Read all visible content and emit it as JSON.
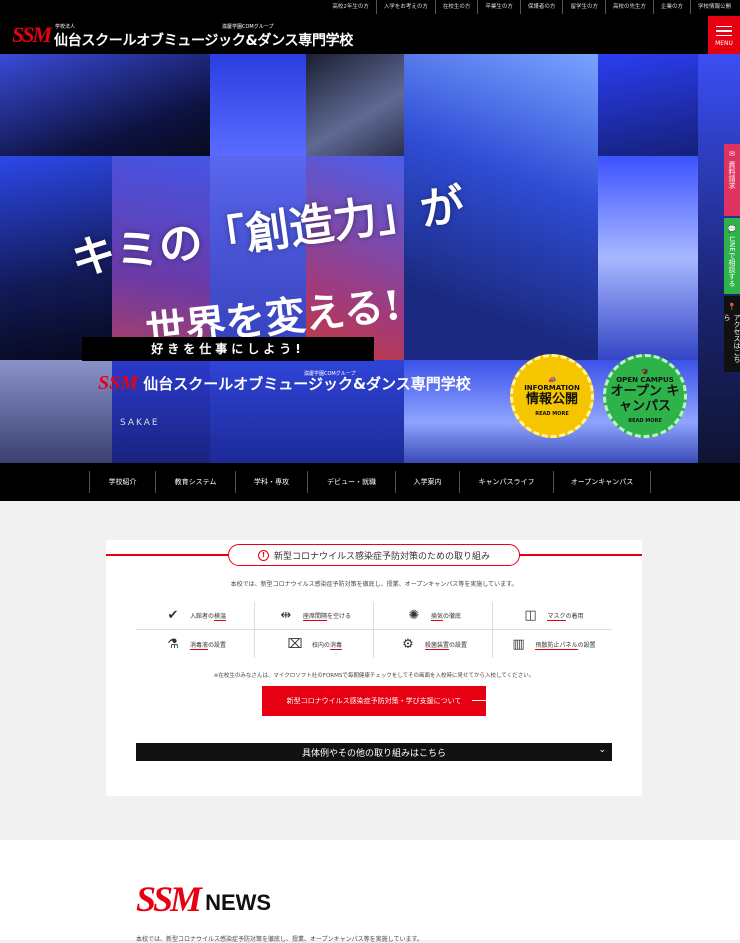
{
  "topbar": {
    "links": [
      "高校2年生の方",
      "入学をお考えの方",
      "在校生の方",
      "卒業生の方",
      "保護者の方",
      "留学生の方",
      "高校の先生方",
      "企業の方",
      "学校情報公開"
    ]
  },
  "header": {
    "logo_mark": "SSM",
    "corp_label": "学校法人",
    "group_label": "滋慶学園COMグループ",
    "school_name": "仙台スクールオブミュージック&ダンス専門学校",
    "menu_label": "MENU"
  },
  "hero": {
    "copy_line1": "キミの「創造力」が",
    "copy_line2": "世界を変える!",
    "tagline": "好きを仕事にしよう!",
    "logo_mark": "SSM",
    "logo_name": "仙台スクールオブミュージック&ダンス専門学校",
    "logo_group": "滋慶学園COMグループ",
    "drum_text": "SAKAE",
    "badge_info": {
      "top": "INFORMATION",
      "main": "情報公開",
      "more": "READ MORE"
    },
    "badge_oc": {
      "top": "OPEN CAMPUS",
      "main": "オープン キャンパス",
      "more": "READ MORE"
    }
  },
  "side_tabs": [
    "資料請求",
    "LINEで相談する",
    "アクセスはこちら"
  ],
  "gnav": {
    "items": [
      "学校紹介",
      "教育システム",
      "学科・専攻",
      "デビュー・就職",
      "入学案内",
      "キャンパスライフ",
      "オープンキャンパス"
    ]
  },
  "covid": {
    "title": "新型コロナウイルス感染症予防対策のための取り組み",
    "description": "本校では、新型コロナウイルス感染症予防対策を徹底し、授業、オープンキャンパス等を実施しています。",
    "measures": [
      {
        "icon": "check-icon",
        "glyph": "✔",
        "pre": "入館者の",
        "hl": "検温",
        "post": ""
      },
      {
        "icon": "distance-icon",
        "glyph": "⇹",
        "pre": "",
        "hl": "座席間隔",
        "post": "を空ける"
      },
      {
        "icon": "ventilation-icon",
        "glyph": "✺",
        "pre": "",
        "hl": "換気",
        "post": "の徹底"
      },
      {
        "icon": "mask-icon",
        "glyph": "◫",
        "pre": "",
        "hl": "マスク",
        "post": "の着用"
      },
      {
        "icon": "disinfectant-icon",
        "glyph": "⚗",
        "pre": "",
        "hl": "消毒液",
        "post": "の設置"
      },
      {
        "icon": "sanitize-icon",
        "glyph": "⌧",
        "pre": "校内の",
        "hl": "消毒",
        "post": ""
      },
      {
        "icon": "sterilizer-icon",
        "glyph": "⚙",
        "pre": "",
        "hl": "殺菌装置",
        "post": "の設置"
      },
      {
        "icon": "partition-icon",
        "glyph": "▥",
        "pre": "",
        "hl": "飛散防止パネル",
        "post": "の設置"
      }
    ],
    "note": "※在校生のみなさんは、マイクロソフト社のFORMSで毎朝健康チェックをしてその画面を入校時に見せてから入校してください。",
    "button_label": "新型コロナウイルス感染症予防対策・学び支援について",
    "accordion_label": "具体例やその他の取り組みはこちら"
  },
  "news": {
    "logo_mark": "SSM",
    "title": "NEWS",
    "description": "本校では、新型コロナウイルス感染症予防対策を徹底し、授業、オープンキャンパス等を実施しています。"
  },
  "colors": {
    "brand_red": "#e60012",
    "info_yellow": "#f5c500",
    "campus_green": "#2eb24a",
    "line_green": "#2eb24a",
    "pink": "#e0325e"
  }
}
